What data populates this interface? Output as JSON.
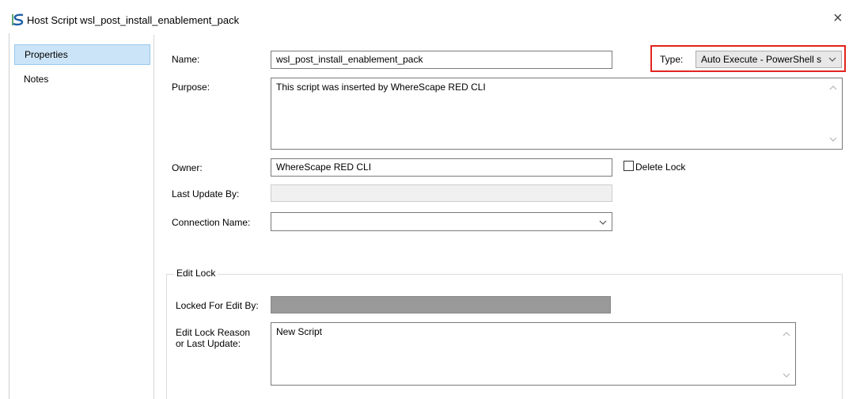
{
  "window": {
    "title": "Host Script wsl_post_install_enablement_pack",
    "close_glyph": "×"
  },
  "sidebar": {
    "items": [
      {
        "label": "Properties",
        "active": true
      },
      {
        "label": "Notes",
        "active": false
      }
    ]
  },
  "form": {
    "name": {
      "label": "Name:",
      "value": "wsl_post_install_enablement_pack"
    },
    "type": {
      "label": "Type:",
      "value": "Auto Execute - PowerShell s"
    },
    "purpose": {
      "label": "Purpose:",
      "value": "This script was inserted by WhereScape RED CLI"
    },
    "owner": {
      "label": "Owner:",
      "value": "WhereScape RED CLI"
    },
    "delete_lock": {
      "label": "Delete Lock",
      "checked": false
    },
    "last_update_by": {
      "label": "Last Update By:",
      "value": ""
    },
    "connection_name": {
      "label": "Connection Name:",
      "value": ""
    }
  },
  "edit_lock": {
    "title": "Edit Lock",
    "locked_for_edit_by": {
      "label": "Locked For Edit By:",
      "value": ""
    },
    "reason": {
      "label_line1": "Edit Lock Reason",
      "label_line2": "or Last Update:",
      "value": "New Script"
    }
  },
  "colors": {
    "highlight_border": "#e2251f",
    "selected_bg": "#cce4f7"
  }
}
